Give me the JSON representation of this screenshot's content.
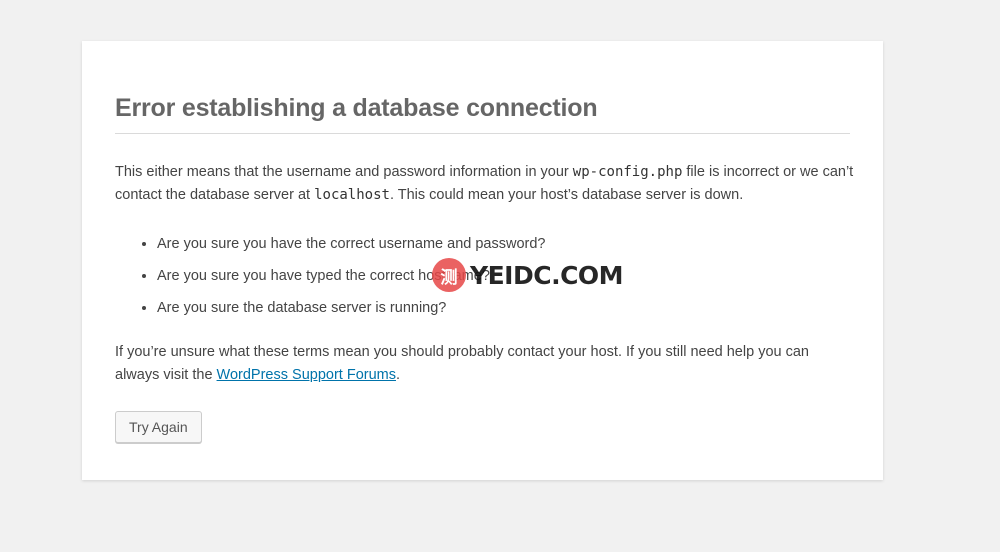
{
  "error": {
    "title": "Error establishing a database connection",
    "intro": {
      "part1": "This either means that the username and password information in your ",
      "config_file": "wp-config.php",
      "part2": " file is incorrect or we can’t contact the database server at ",
      "host": "localhost",
      "part3": ". This could mean your host’s database server is down."
    },
    "checklist": [
      "Are you sure you have the correct username and password?",
      "Are you sure you have typed the correct hostname?",
      "Are you sure the database server is running?"
    ],
    "help": {
      "part1": "If you’re unsure what these terms mean you should probably contact your host. If you still need help you can always visit the ",
      "link_label": "WordPress Support Forums",
      "part2": "."
    },
    "try_again_label": "Try Again"
  },
  "watermark": {
    "logo_text": "测",
    "text": "YEIDC.COM"
  },
  "colors": {
    "background": "#f1f1f1",
    "card": "#ffffff",
    "title": "#666666",
    "link": "#0073aa"
  }
}
